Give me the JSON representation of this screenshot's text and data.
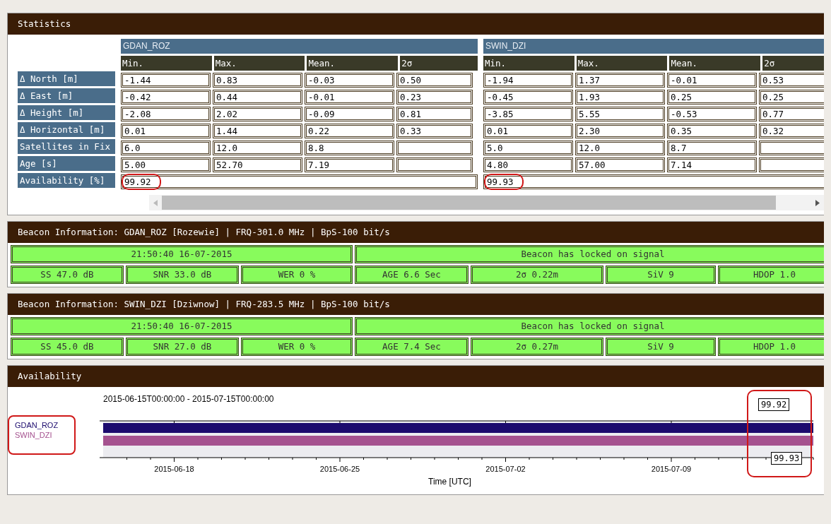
{
  "statistics": {
    "title": "Statistics",
    "availability_label": "Availability [%]",
    "stations": [
      {
        "name": "GDAN_ROZ",
        "columns": [
          "Min.",
          "Max.",
          "Mean.",
          "2σ"
        ],
        "availability": "99.92",
        "highlighted": true
      },
      {
        "name": "SWIN_DZI",
        "columns": [
          "Min.",
          "Max.",
          "Mean.",
          "2σ"
        ],
        "availability": "99.93",
        "highlighted": true
      }
    ],
    "rows": [
      {
        "label": "Δ North [m]",
        "values": [
          [
            "-1.44",
            "0.83",
            "-0.03",
            "0.50"
          ],
          [
            "-1.94",
            "1.37",
            "-0.01",
            "0.53"
          ]
        ]
      },
      {
        "label": "Δ East [m]",
        "values": [
          [
            "-0.42",
            "0.44",
            "-0.01",
            "0.23"
          ],
          [
            "-0.45",
            "1.93",
            "0.25",
            "0.25"
          ]
        ]
      },
      {
        "label": "Δ Height [m]",
        "values": [
          [
            "-2.08",
            "2.02",
            "-0.09",
            "0.81"
          ],
          [
            "-3.85",
            "5.55",
            "-0.53",
            "0.77"
          ]
        ]
      },
      {
        "label": "Δ Horizontal [m]",
        "values": [
          [
            "0.01",
            "1.44",
            "0.22",
            "0.33"
          ],
          [
            "0.01",
            "2.30",
            "0.35",
            "0.32"
          ]
        ]
      },
      {
        "label": "Satellites in Fix",
        "values": [
          [
            "6.0",
            "12.0",
            "8.8"
          ],
          [
            "5.0",
            "12.0",
            "8.7"
          ]
        ]
      },
      {
        "label": "Age [s]",
        "values": [
          [
            "5.00",
            "52.70",
            "7.19"
          ],
          [
            "4.80",
            "57.00",
            "7.14"
          ]
        ]
      }
    ]
  },
  "beacons": [
    {
      "title": "Beacon Information: GDAN_ROZ [Rozewie] | FRQ-301.0 MHz | BpS-100 bit/s",
      "time": "21:50:40 16-07-2015",
      "status": "Beacon has locked on signal",
      "cells": [
        "SS 47.0 dB",
        "SNR 33.0 dB",
        "WER 0 %",
        "AGE 6.6 Sec",
        "2σ 0.22m",
        "SiV 9",
        "HDOP 1.0"
      ]
    },
    {
      "title": "Beacon Information: SWIN_DZI [Dziwnow] | FRQ-283.5 MHz | BpS-100 bit/s",
      "time": "21:50:40 16-07-2015",
      "status": "Beacon has locked on signal",
      "cells": [
        "SS 45.0 dB",
        "SNR 27.0 dB",
        "WER 0 %",
        "AGE 7.4 Sec",
        "2σ 0.27m",
        "SiV 9",
        "HDOP 1.0"
      ]
    }
  ],
  "availability": {
    "title": "Availability",
    "range": "2015-06-15T00:00:00 - 2015-07-15T00:00:00",
    "xlabel": "Time [UTC]",
    "xticks": [
      "2015-06-18",
      "2015-06-25",
      "2015-07-02",
      "2015-07-09"
    ],
    "legend_highlighted": true,
    "values_highlighted": true,
    "series": [
      {
        "name": "GDAN_ROZ",
        "color": "#1c0b6e",
        "value": "99.92"
      },
      {
        "name": "SWIN_DZI",
        "color": "#a5528f",
        "value": "99.93"
      }
    ]
  }
}
